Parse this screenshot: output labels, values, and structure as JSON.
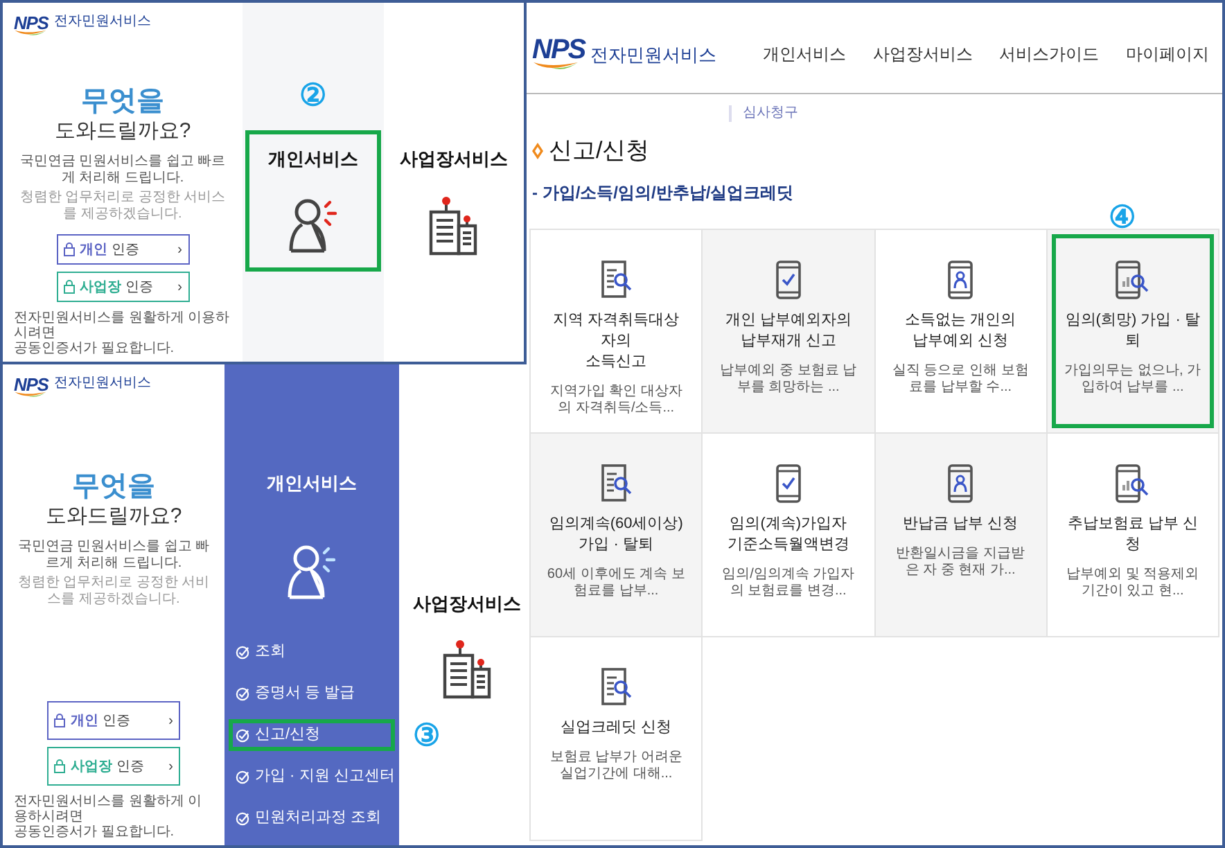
{
  "left_panels": [
    {
      "kind": "home",
      "logo": {
        "mark": "NPS",
        "name": "전자민원서비스"
      },
      "headline": "무엇을",
      "subheadline": "도와드릴까요?",
      "descriptions": [
        "국민연금 민원서비스를 쉽고 빠르게 처리해 드립니다.",
        "청렴한 업무처리로 공정한 서비스를 제공하겠습니다."
      ],
      "auth_buttons": [
        {
          "label": "**개인** 인증",
          "arrow": "›",
          "color": "#5b63c4"
        },
        {
          "label": "**사업장** 인증",
          "arrow": "›",
          "color": "#2fae92"
        }
      ],
      "note_lines": [
        "전자민원서비스를 원활하게 이용하시려면",
        "공동인증서가 필요합니다."
      ],
      "services": [
        {
          "title": "개인서비스",
          "kind": "person",
          "expanded": false,
          "highlighted": true,
          "step": "②"
        },
        {
          "title": "사업장서비스",
          "kind": "building",
          "expanded": false,
          "highlighted": false
        }
      ]
    },
    {
      "kind": "home",
      "logo": {
        "mark": "NPS",
        "name": "전자민원서비스"
      },
      "headline": "무엇을",
      "subheadline": "도와드릴까요?",
      "descriptions": [
        "국민연금 민원서비스를 쉽고 빠르게 처리해 드립니다.",
        "청렴한 업무처리로 공정한 서비스를 제공하겠습니다."
      ],
      "auth_buttons": [
        {
          "label": "**개인** 인증",
          "arrow": "›",
          "color": "#5b63c4"
        },
        {
          "label": "**사업장** 인증",
          "arrow": "›",
          "color": "#2fae92"
        }
      ],
      "note_lines": [
        "전자민원서비스를 원활하게 이용하시려면",
        "공동인증서가 필요합니다."
      ],
      "services": [
        {
          "title": "개인서비스",
          "kind": "person",
          "expanded": true,
          "highlighted": false,
          "menu": [
            {
              "label": "조회",
              "highlighted": false
            },
            {
              "label": "증명서 등 발급",
              "highlighted": false
            },
            {
              "label": "신고/신청",
              "highlighted": true,
              "step": "③"
            },
            {
              "label": "가입 · 지원 신고센터",
              "highlighted": false
            },
            {
              "label": "민원처리과정 조회",
              "highlighted": false
            }
          ]
        },
        {
          "title": "사업장서비스",
          "kind": "building",
          "expanded": false,
          "highlighted": false
        }
      ]
    }
  ],
  "right_panel": {
    "logo": {
      "mark": "NPS",
      "name": "전자민원서비스"
    },
    "nav": [
      "개인서비스",
      "사업장서비스",
      "서비스가이드",
      "마이페이지"
    ],
    "submenu_fragment": "심사청구",
    "page_title": "신고/신청",
    "category": "- 가입/소득/임의/반추납/실업크레딧",
    "cards": [
      {
        "kind": "doc-search",
        "title_lines": [
          "지역 자격취득대상자의",
          "소득신고"
        ],
        "desc": "지역가입 확인 대상자의 자격취득/소득...",
        "shaded": false,
        "highlighted": false
      },
      {
        "kind": "phone-check",
        "title_lines": [
          "개인 납부예외자의",
          "납부재개 신고"
        ],
        "desc": "납부예외 중 보험료 납부를 희망하는 ...",
        "shaded": true,
        "highlighted": false
      },
      {
        "kind": "phone-person",
        "title_lines": [
          "소득없는 개인의",
          "납부예외 신청"
        ],
        "desc": "실직 등으로 인해 보험료를 납부할 수...",
        "shaded": false,
        "highlighted": false
      },
      {
        "kind": "phone-chart",
        "title_lines": [
          "임의(희망) 가입 · 탈퇴"
        ],
        "desc": "가입의무는 없으나, 가입하여 납부를 ...",
        "shaded": true,
        "highlighted": true,
        "step": "④"
      },
      {
        "kind": "doc-search",
        "title_lines": [
          "임의계속(60세이상) 가입 · 탈퇴"
        ],
        "desc": "60세 이후에도 계속 보험료를 납부...",
        "shaded": true,
        "highlighted": false
      },
      {
        "kind": "phone-check",
        "title_lines": [
          "임의(계속)가입자",
          "기준소득월액변경"
        ],
        "desc": "임의/임의계속 가입자의 보험료를 변경...",
        "shaded": false,
        "highlighted": false
      },
      {
        "kind": "phone-person",
        "title_lines": [
          "반납금 납부 신청"
        ],
        "desc": "반환일시금을 지급받은 자 중 현재 가...",
        "shaded": true,
        "highlighted": false
      },
      {
        "kind": "phone-chart",
        "title_lines": [
          "추납보험료 납부 신청"
        ],
        "desc": "납부예외 및 적용제외 기간이 있고 현...",
        "shaded": false,
        "highlighted": false
      },
      {
        "kind": "doc-search",
        "title_lines": [
          "실업크레딧 신청"
        ],
        "desc": "보험료 납부가 어려운 실업기간에 대해...",
        "shaded": false,
        "highlighted": false
      }
    ]
  }
}
